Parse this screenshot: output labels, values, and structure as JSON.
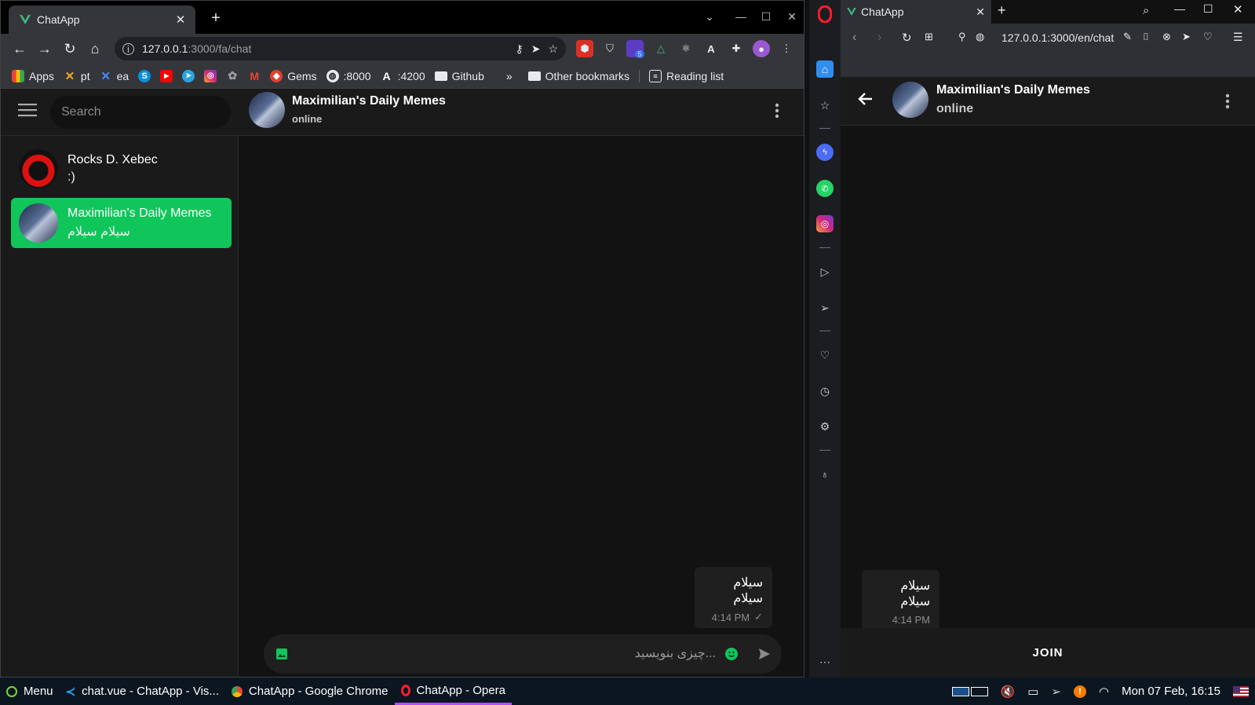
{
  "chrome": {
    "tab_title": "ChatApp",
    "url_host": "127.0.0.1",
    "url_path": ":3000/fa/chat",
    "ext_badge": "5",
    "bookmarks": [
      {
        "label": "Apps",
        "icon": "apps-grid-icon"
      },
      {
        "label": "pt",
        "icon": "x-logo-icon"
      },
      {
        "label": "ea",
        "icon": "x-logo-icon"
      },
      {
        "label": "",
        "icon": "skype-icon"
      },
      {
        "label": "",
        "icon": "youtube-icon"
      },
      {
        "label": "",
        "icon": "telegram-icon"
      },
      {
        "label": "",
        "icon": "instagram-icon"
      },
      {
        "label": "",
        "icon": "openai-icon"
      },
      {
        "label": "",
        "icon": "gmail-icon"
      },
      {
        "label": "Gems",
        "icon": "gem-icon"
      },
      {
        "label": ":8000",
        "icon": "globe-icon"
      },
      {
        "label": ":4200",
        "icon": "angular-icon"
      },
      {
        "label": "Github",
        "icon": "folder-icon"
      }
    ],
    "more_bookmarks": "»",
    "other_bookmarks": "Other bookmarks",
    "reading_list": "Reading list"
  },
  "chat_app": {
    "search_placeholder": "Search",
    "chats": [
      {
        "name": "Rocks D. Xebec",
        "last_message": ":)"
      },
      {
        "name": "Maximilian's Daily Memes",
        "last_message": "سیلام سیلام"
      }
    ],
    "header": {
      "title": "Maximilian's Daily Memes",
      "status": "online"
    },
    "message": {
      "text": "سیلام سیلام",
      "time": "4:14 PM"
    },
    "composer_placeholder": "...چیزی بنویسید"
  },
  "opera": {
    "tab_title": "ChatApp",
    "url": "127.0.0.1:3000/en/chat",
    "header": {
      "title": "Maximilian's Daily Memes",
      "status": "online"
    },
    "message": {
      "text": "سیلام سیلام",
      "time": "4:14 PM"
    },
    "join_label": "JOIN"
  },
  "taskbar": {
    "menu": "Menu",
    "tasks": [
      "chat.vue - ChatApp - Vis...",
      "ChatApp - Google Chrome",
      "ChatApp - Opera"
    ],
    "clock": "Mon 07 Feb, 16:15"
  },
  "colors": {
    "accent_green": "#10c55a",
    "opera_red": "#ff1b2d",
    "taskbar_active": "#b44dff"
  }
}
